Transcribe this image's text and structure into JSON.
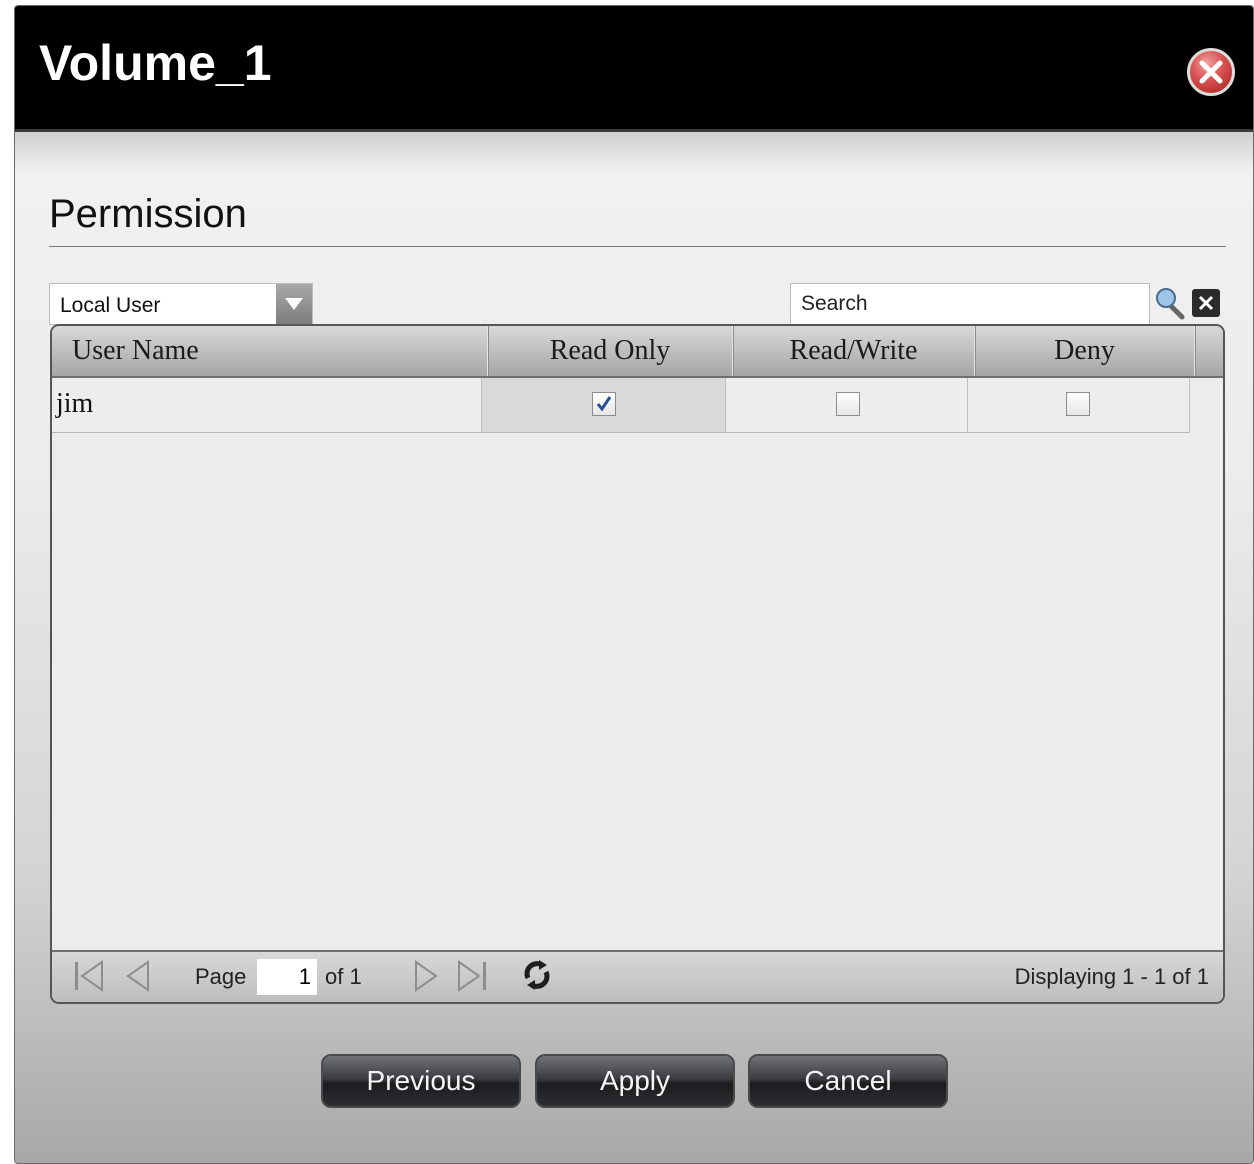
{
  "dialog": {
    "title": "Volume_1"
  },
  "section": {
    "title": "Permission"
  },
  "filter": {
    "selected": "Local User"
  },
  "search": {
    "value": "Search"
  },
  "table": {
    "columns": [
      "User Name",
      "Read Only",
      "Read/Write",
      "Deny"
    ],
    "rows": [
      {
        "name": "jim",
        "read_only": true,
        "read_write": false,
        "deny": false
      }
    ]
  },
  "pager": {
    "page_label": "Page",
    "page_value": "1",
    "of_label": "of 1",
    "display_text": "Displaying 1 - 1 of 1"
  },
  "buttons": {
    "previous": "Previous",
    "apply": "Apply",
    "cancel": "Cancel"
  },
  "colors": {
    "title_bg": "#000000",
    "close_red": "#d95454",
    "button_dark": "#2c2e31"
  }
}
